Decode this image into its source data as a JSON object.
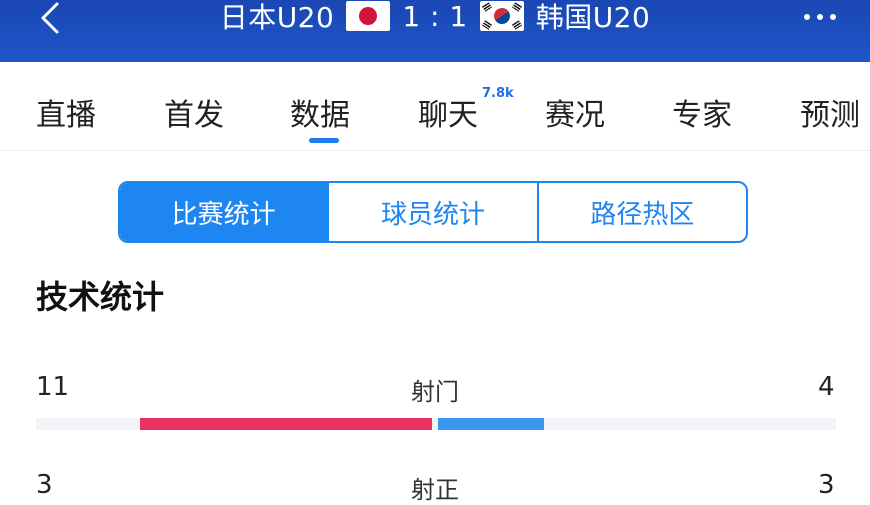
{
  "header": {
    "home_team": "日本U20",
    "score": "1 : 1",
    "away_team": "韩国U20"
  },
  "tabs": [
    {
      "label": "直播"
    },
    {
      "label": "首发"
    },
    {
      "label": "数据"
    },
    {
      "label": "聊天",
      "badge": "7.8k"
    },
    {
      "label": "赛况"
    },
    {
      "label": "专家"
    },
    {
      "label": "预测"
    }
  ],
  "active_tab": "数据",
  "segments": [
    "比赛统计",
    "球员统计",
    "路径热区"
  ],
  "active_segment": "比赛统计",
  "section_title": "技术统计",
  "stats": [
    {
      "label": "射门",
      "home": "11",
      "away": "4"
    },
    {
      "label": "射正",
      "home": "3",
      "away": "3"
    }
  ],
  "colors": {
    "header_bg": "#1f56c8",
    "accent": "#1e86f0",
    "home_bar": "#e73361",
    "away_bar": "#3a97ee"
  }
}
